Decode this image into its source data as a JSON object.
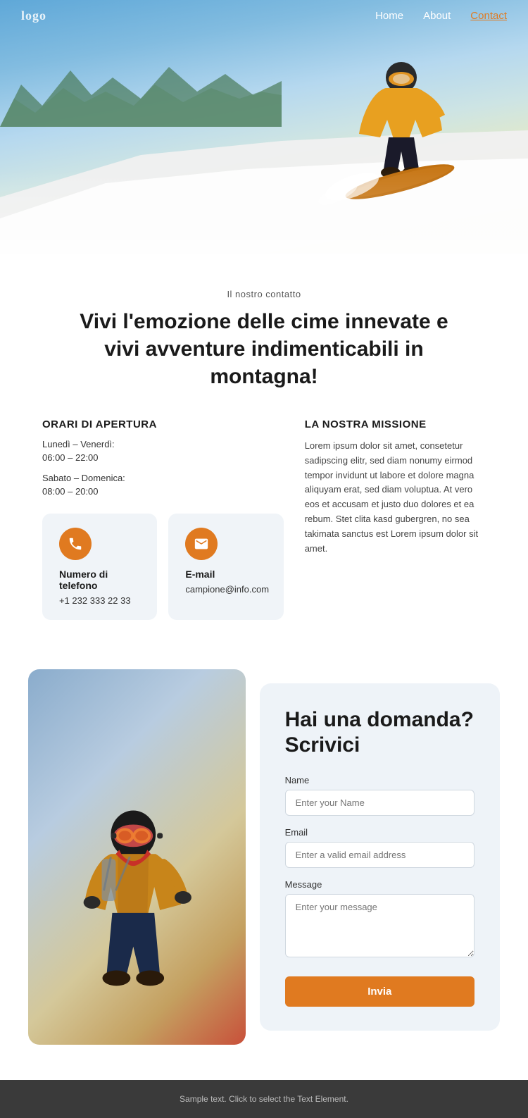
{
  "nav": {
    "logo": "logo",
    "links": [
      {
        "label": "Home",
        "href": "#",
        "active": false
      },
      {
        "label": "About",
        "href": "#",
        "active": false
      },
      {
        "label": "Contact",
        "href": "#",
        "active": true
      }
    ]
  },
  "hero": {
    "alt": "Snowboarder on mountain slope"
  },
  "contact": {
    "label": "Il nostro contatto",
    "headline": "Vivi l'emozione delle cime innevate e vivi avventure indimenticabili in montagna!"
  },
  "hours": {
    "title": "ORARI DI APERTURA",
    "weekday_label": "Lunedì – Venerdì:",
    "weekday_hours": "06:00 – 22:00",
    "weekend_label": "Sabato – Domenica:",
    "weekend_hours": "08:00 – 20:00"
  },
  "mission": {
    "title": "LA NOSTRA MISSIONE",
    "text": "Lorem ipsum dolor sit amet, consetetur sadipscing elitr, sed diam nonumy eirmod tempor invidunt ut labore et dolore magna aliquyam erat, sed diam voluptua. At vero eos et accusam et justo duo dolores et ea rebum. Stet clita kasd gubergren, no sea takimata sanctus est Lorem ipsum dolor sit amet."
  },
  "cards": [
    {
      "icon": "phone-icon",
      "title": "Numero di telefono",
      "value": "+1 232 333 22 33"
    },
    {
      "icon": "email-icon",
      "title": "E-mail",
      "value": "campione@info.com"
    }
  ],
  "form": {
    "title": "Hai una domanda?\nScrivici",
    "name_label": "Name",
    "name_placeholder": "Enter your Name",
    "email_label": "Email",
    "email_placeholder": "Enter a valid email address",
    "message_label": "Message",
    "message_placeholder": "Enter your message",
    "submit_label": "Invia"
  },
  "footer": {
    "text": "Sample text. Click to select the Text Element."
  }
}
